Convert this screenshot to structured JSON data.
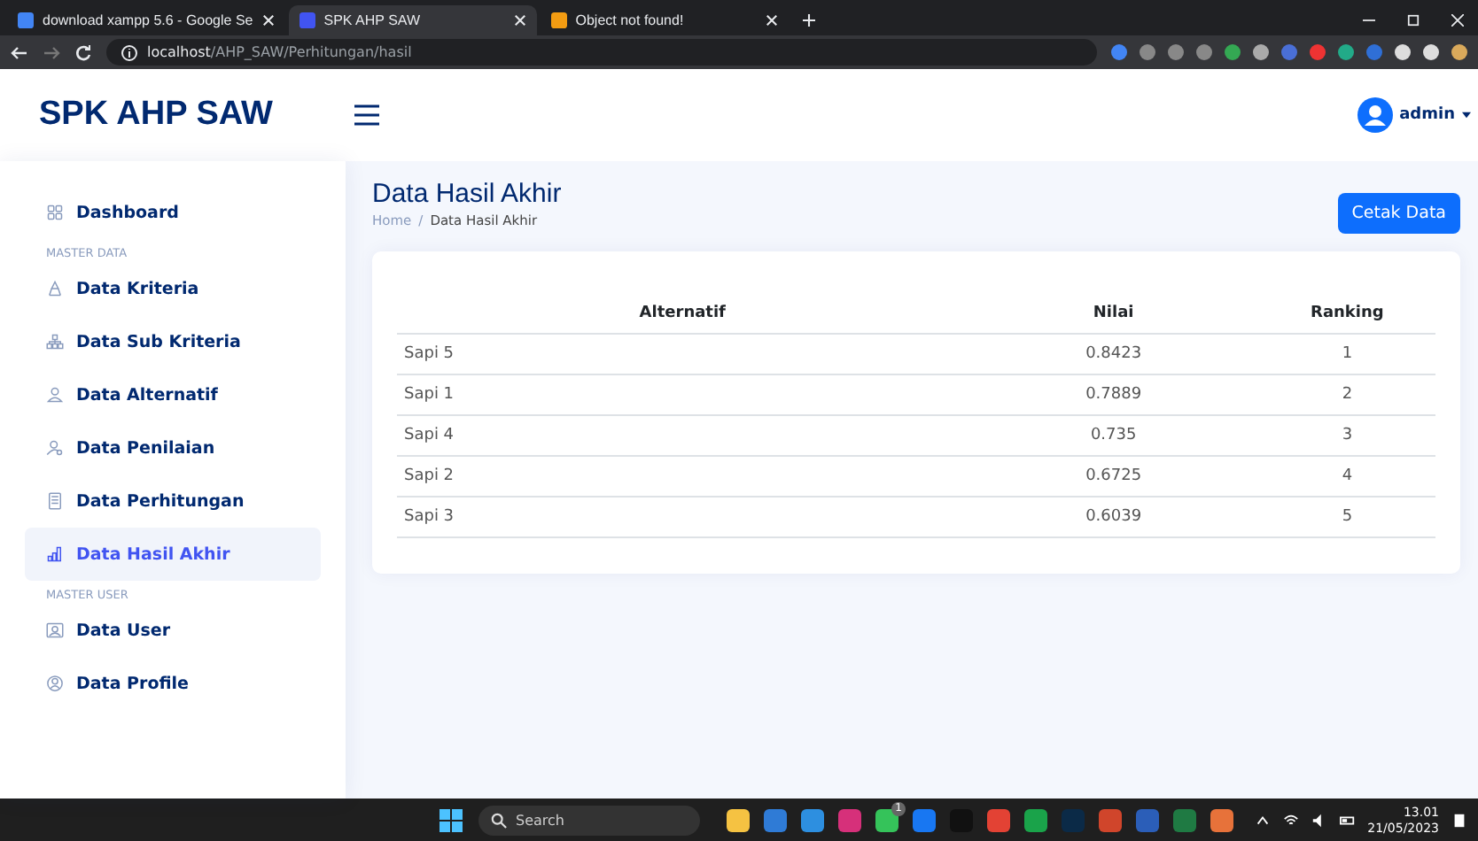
{
  "browser": {
    "tabs": [
      {
        "title": "download xampp 5.6 - Google Se",
        "selected": false
      },
      {
        "title": "SPK AHP SAW",
        "selected": true
      },
      {
        "title": "Object not found!",
        "selected": false
      }
    ],
    "address": {
      "host": "localhost",
      "path": "/AHP_SAW/Perhitungan/hasil"
    }
  },
  "header": {
    "brand": "SPK AHP SAW",
    "user": "admin"
  },
  "sidebar": {
    "items": [
      {
        "kind": "link",
        "label": "Dashboard",
        "selected": false
      },
      {
        "kind": "heading",
        "label": "MASTER DATA"
      },
      {
        "kind": "link",
        "label": "Data Kriteria",
        "selected": false
      },
      {
        "kind": "link",
        "label": "Data Sub Kriteria",
        "selected": false
      },
      {
        "kind": "link",
        "label": "Data Alternatif",
        "selected": false
      },
      {
        "kind": "link",
        "label": "Data Penilaian",
        "selected": false
      },
      {
        "kind": "link",
        "label": "Data Perhitungan",
        "selected": false
      },
      {
        "kind": "link",
        "label": "Data Hasil Akhir",
        "selected": true
      },
      {
        "kind": "heading",
        "label": "MASTER USER"
      },
      {
        "kind": "link",
        "label": "Data User",
        "selected": false
      },
      {
        "kind": "link",
        "label": "Data Profile",
        "selected": false
      }
    ]
  },
  "page": {
    "title": "Data Hasil Akhir",
    "breadcrumb": [
      "Home",
      "/",
      "Data Hasil Akhir"
    ],
    "print_button": "Cetak Data"
  },
  "table": {
    "columns": [
      "Alternatif",
      "Nilai",
      "Ranking"
    ],
    "rows": [
      [
        "Sapi 5",
        "0.8423",
        "1"
      ],
      [
        "Sapi 1",
        "0.7889",
        "2"
      ],
      [
        "Sapi 4",
        "0.735",
        "3"
      ],
      [
        "Sapi 2",
        "0.6725",
        "4"
      ],
      [
        "Sapi 3",
        "0.6039",
        "5"
      ]
    ]
  },
  "taskbar": {
    "search_placeholder": "Search",
    "badge": "1",
    "time": "13.01",
    "date": "21/05/2023"
  }
}
